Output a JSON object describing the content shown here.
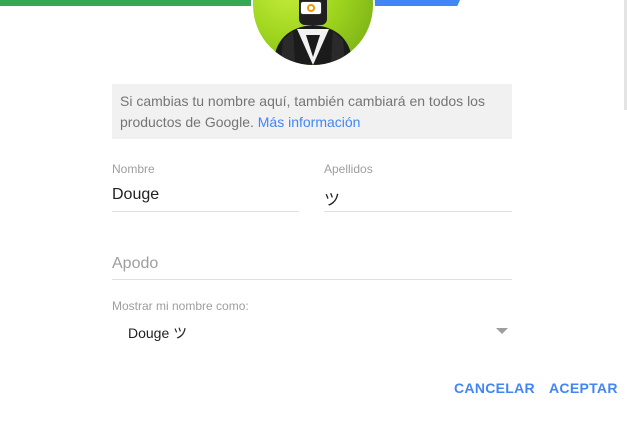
{
  "dialog": {
    "info_text": "Si cambias tu nombre aquí, también cambiará en todos los productos de Google.",
    "info_link": "Más información",
    "avatar_icon": "profile-photo-icon",
    "camera_icon": "camera-icon"
  },
  "fields": {
    "first_name": {
      "label": "Nombre",
      "value": "Douge"
    },
    "last_name": {
      "label": "Apellidos",
      "value": "ツ"
    },
    "nickname": {
      "placeholder": "Apodo",
      "value": ""
    },
    "display_name": {
      "label": "Mostrar mi nombre como:",
      "selected": "Douge ツ"
    }
  },
  "buttons": {
    "cancel": "CANCELAR",
    "accept": "ACEPTAR"
  },
  "colors": {
    "accent": "#4285f4",
    "green": "#34a853",
    "info_bg": "#f1f1f1",
    "label": "#9e9e9e"
  }
}
